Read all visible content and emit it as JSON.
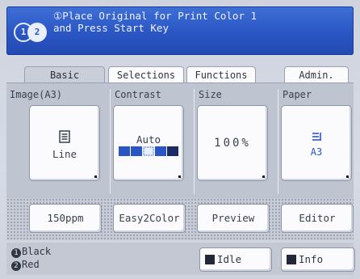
{
  "header": {
    "circle1": "1",
    "circle2": "2",
    "message": "①Place Original for Print Color 1\nand Press Start Key"
  },
  "tabs": [
    {
      "label": "Basic",
      "active": true
    },
    {
      "label": "Selections",
      "active": false
    },
    {
      "label": "Functions",
      "active": false
    },
    {
      "label": "Admin.",
      "active": false
    }
  ],
  "sections": {
    "image": {
      "title": "Image(A3)",
      "value": "Line",
      "icon": "document-icon"
    },
    "contrast": {
      "title": "Contrast",
      "value": "Auto",
      "level": 3,
      "levels": 5
    },
    "size": {
      "title": "Size",
      "value": "100%"
    },
    "paper": {
      "title": "Paper",
      "value": "A3",
      "icon": "paper-stack-icon"
    }
  },
  "toolbar": {
    "ppm": "150ppm",
    "easy2color": "Easy2Color",
    "preview": "Preview",
    "editor": "Editor"
  },
  "status": {
    "ink1_num": "1",
    "ink1": "Black",
    "ink2_num": "2",
    "ink2": "Red",
    "idle": "Idle",
    "info": "Info"
  },
  "colors": {
    "header_blue": "#2a56c4",
    "panel_gray": "#bec4d0"
  }
}
